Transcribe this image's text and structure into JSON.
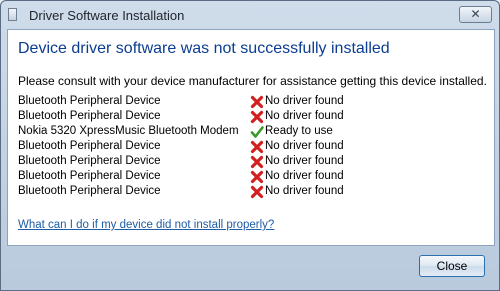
{
  "window": {
    "title": "Driver Software Installation",
    "close_glyph": "✕"
  },
  "content": {
    "heading": "Device driver software was not successfully installed",
    "instruction": "Please consult with your device manufacturer for assistance getting this device installed.",
    "devices": [
      {
        "name": "Bluetooth Peripheral Device",
        "status": "No driver found",
        "icon": "error-x-icon"
      },
      {
        "name": "Bluetooth Peripheral Device",
        "status": "No driver found",
        "icon": "error-x-icon"
      },
      {
        "name": "Nokia 5320 XpressMusic Bluetooth Modem",
        "status": "Ready to use",
        "icon": "check-icon"
      },
      {
        "name": "Bluetooth Peripheral Device",
        "status": "No driver found",
        "icon": "error-x-icon"
      },
      {
        "name": "Bluetooth Peripheral Device",
        "status": "No driver found",
        "icon": "error-x-icon"
      },
      {
        "name": "Bluetooth Peripheral Device",
        "status": "No driver found",
        "icon": "error-x-icon"
      },
      {
        "name": "Bluetooth Peripheral Device",
        "status": "No driver found",
        "icon": "error-x-icon"
      }
    ],
    "help_link": "What can I do if my device did not install properly?"
  },
  "footer": {
    "close_label": "Close"
  },
  "colors": {
    "heading": "#0b3d91",
    "link": "#1e5ca8",
    "error": "#d21f1f",
    "success": "#3a9a2a"
  }
}
